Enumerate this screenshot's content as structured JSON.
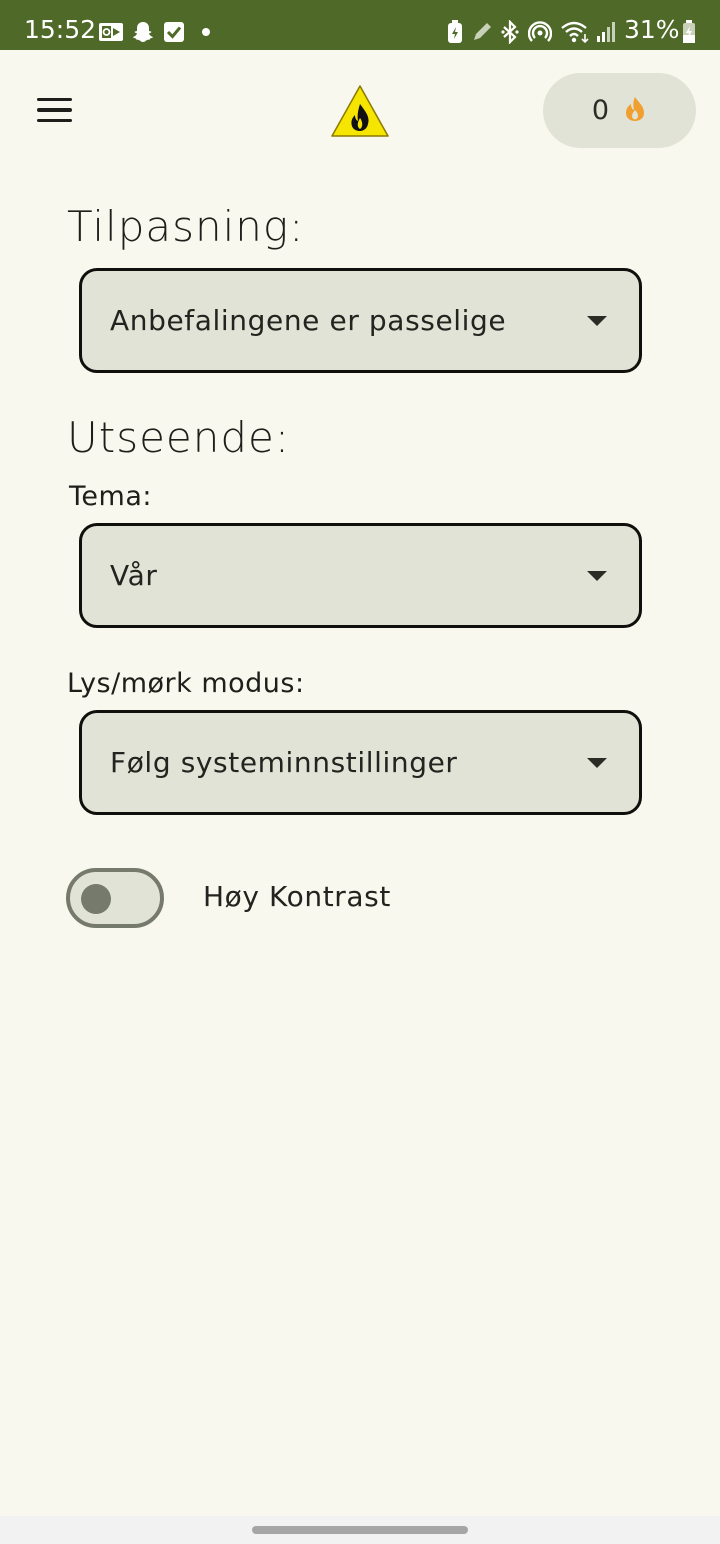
{
  "status_bar": {
    "time": "15:52",
    "notification_icons": [
      "outlook-icon",
      "snapchat-icon",
      "checkbox-icon",
      "dot-icon"
    ],
    "system_icons": [
      "battery-saver-icon",
      "pencil-icon",
      "bluetooth-icon",
      "hotspot-icon",
      "wifi-icon",
      "signal-icon",
      "battery-charging-icon"
    ],
    "battery_percent": "31%",
    "background_color": "#4f6a28"
  },
  "header": {
    "menu_icon": "hamburger-menu-icon",
    "logo_icon": "fire-warning-triangle-icon",
    "streak": {
      "count": "0",
      "icon": "flame-icon",
      "icon_color": "#f0a030"
    }
  },
  "sections": {
    "tilpasning": {
      "title": "Tilpasning:",
      "dropdown_value": "Anbefalingene er passelige"
    },
    "utseende": {
      "title": "Utseende:",
      "theme_label": "Tema:",
      "theme_value": "Vår",
      "mode_label": "Lys/mørk modus:",
      "mode_value": "Følg systeminnstillinger",
      "high_contrast_label": "Høy Kontrast",
      "high_contrast_on": false
    }
  },
  "colors": {
    "background": "#f9f8ee",
    "field_fill": "#e1e3d6",
    "field_border": "#0f100c",
    "toggle_off": "#767a6c"
  }
}
